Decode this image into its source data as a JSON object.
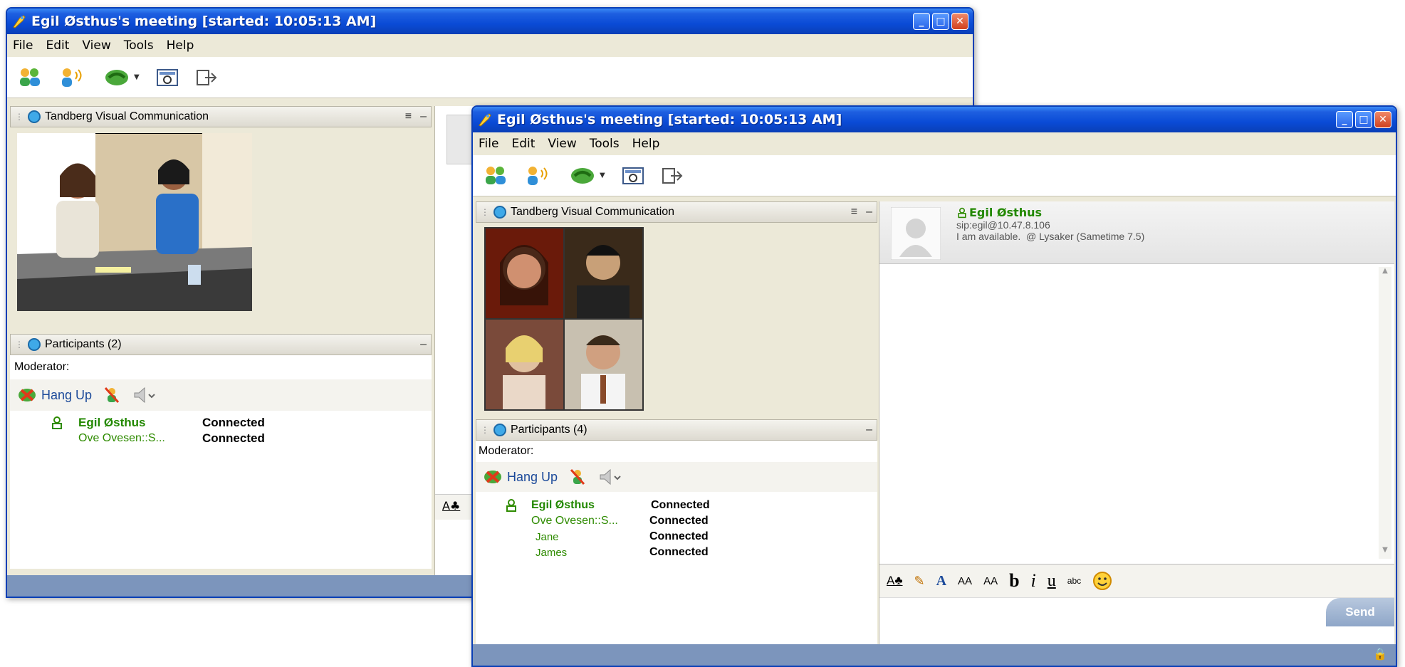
{
  "back_window": {
    "title": "Egil Østhus's meeting [started: 10:05:13 AM]",
    "menu": [
      "File",
      "Edit",
      "View",
      "Tools",
      "Help"
    ],
    "video_panel_title": "Tandberg Visual Communication",
    "participants_title": "Participants (2)",
    "moderator_label": "Moderator:",
    "hangup_label": "Hang Up",
    "participants": [
      {
        "name": "Egil Østhus",
        "status": "Connected"
      },
      {
        "name": "Ove Ovesen::S...",
        "status": "Connected"
      }
    ]
  },
  "front_window": {
    "title": "Egil Østhus's meeting [started: 10:05:13 AM]",
    "menu": [
      "File",
      "Edit",
      "View",
      "Tools",
      "Help"
    ],
    "video_panel_title": "Tandberg Visual Communication",
    "participants_title": "Participants (4)",
    "moderator_label": "Moderator:",
    "hangup_label": "Hang Up",
    "participants": [
      {
        "name": "Egil Østhus",
        "status": "Connected"
      },
      {
        "name": "Ove Ovesen::S...",
        "status": "Connected"
      },
      {
        "name": "Jane",
        "status": "Connected"
      },
      {
        "name": "James",
        "status": "Connected"
      }
    ],
    "contact": {
      "name": "Egil Østhus",
      "sip": "sip:egil@10.47.8.106",
      "status": "I am available.  @ Lysaker (Sametime 7.5)"
    },
    "send_label": "Send",
    "format_labels": {
      "font_size_1": "AA",
      "font_size_2": "AA",
      "bold": "b",
      "italic": "i",
      "underline": "u",
      "spell": "abc"
    }
  },
  "colors": {
    "titlebar": "#0a4bd6",
    "participant_green": "#2e8b00",
    "statusbar": "#7c95bc",
    "panel_bg": "#ece9d8"
  }
}
